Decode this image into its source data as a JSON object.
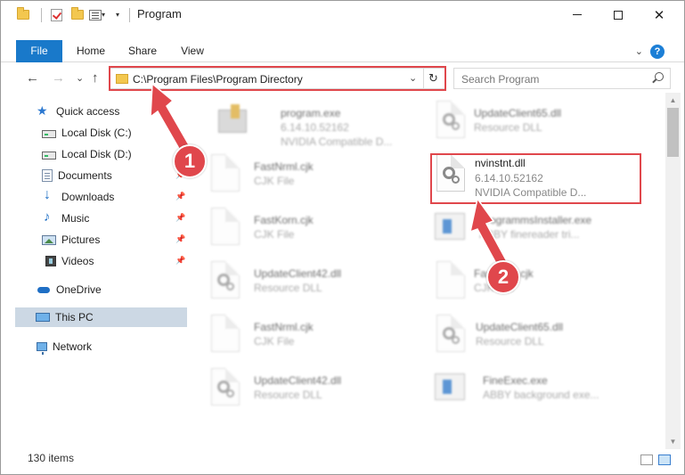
{
  "window": {
    "title": "Program",
    "controls": {
      "minimize_icon": "minimize-icon",
      "maximize_icon": "maximize-icon",
      "close_label": "✕"
    }
  },
  "ribbon": {
    "tabs": [
      {
        "label": "File"
      },
      {
        "label": "Home"
      },
      {
        "label": "Share"
      },
      {
        "label": "View"
      }
    ],
    "help_label": "?",
    "expand_label": "⌄"
  },
  "nav": {
    "back_label": "←",
    "forward_label": "→",
    "recent_label": "⌄",
    "up_label": "↑",
    "address": "C:\\Program Files\\Program Directory",
    "refresh_label": "↻",
    "search_placeholder": "Search Program"
  },
  "sidebar": {
    "items": [
      {
        "label": "Quick access",
        "icon": "quick-access-star-icon"
      },
      {
        "label": "Local Disk (C:)",
        "icon": "drive-icon",
        "pinned": true
      },
      {
        "label": "Local Disk (D:)",
        "icon": "drive-icon",
        "pinned": true
      },
      {
        "label": "Documents",
        "icon": "documents-icon",
        "pinned": true
      },
      {
        "label": "Downloads",
        "icon": "downloads-icon",
        "pinned": true
      },
      {
        "label": "Music",
        "icon": "music-icon",
        "pinned": true
      },
      {
        "label": "Pictures",
        "icon": "pictures-icon",
        "pinned": true
      },
      {
        "label": "Videos",
        "icon": "videos-icon",
        "pinned": true
      },
      {
        "label": "OneDrive",
        "icon": "onedrive-icon"
      },
      {
        "label": "This PC",
        "icon": "this-pc-icon",
        "selected": true
      },
      {
        "label": "Network",
        "icon": "network-icon"
      }
    ]
  },
  "files": [
    {
      "name": "program.exe",
      "line2": "6.14.10.52162",
      "line3": "NVIDIA Compatible D...",
      "icon": "exe-icon"
    },
    {
      "name": "UpdateClient65.dll",
      "line2": "Resource DLL",
      "line3": "",
      "icon": "dll-icon"
    },
    {
      "name": "FastNrml.cjk",
      "line2": "CJK File",
      "line3": "",
      "icon": "file-icon"
    },
    {
      "name": "nvinstnt.dll",
      "line2": "6.14.10.52162",
      "line3": "NVIDIA Compatible D...",
      "icon": "dll-icon",
      "highlighted": true
    },
    {
      "name": "FastKorn.cjk",
      "line2": "CJK File",
      "line3": "",
      "icon": "file-icon"
    },
    {
      "name": "ProgrammsInstaller.exe",
      "line2": "ABBY finereader tri...",
      "line3": "",
      "icon": "setup-icon"
    },
    {
      "name": "UpdateClient42.dll",
      "line2": "Resource DLL",
      "line3": "",
      "icon": "dll-icon"
    },
    {
      "name": "FastKorn.cjk",
      "line2": "CJK File",
      "line3": "",
      "icon": "file-icon"
    },
    {
      "name": "FastNrml.cjk",
      "line2": "CJK File",
      "line3": "",
      "icon": "file-icon"
    },
    {
      "name": "UpdateClient65.dll",
      "line2": "Resource DLL",
      "line3": "",
      "icon": "dll-icon"
    },
    {
      "name": "UpdateClient42.dll",
      "line2": "Resource DLL",
      "line3": "",
      "icon": "dll-icon"
    },
    {
      "name": "FineExec.exe",
      "line2": "ABBY background exe...",
      "line3": "",
      "icon": "setup-icon"
    }
  ],
  "callouts": [
    {
      "label": "1"
    },
    {
      "label": "2"
    }
  ],
  "status": {
    "item_count": "130 items"
  },
  "colors": {
    "accent": "#1979ca",
    "highlight": "#e0474c",
    "selected": "#ccd8e4"
  }
}
